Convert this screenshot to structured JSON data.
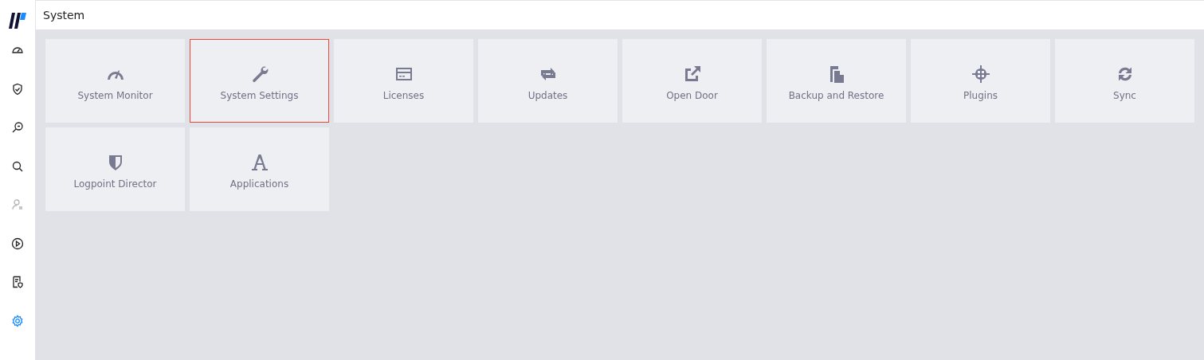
{
  "header": {
    "title": "System"
  },
  "sidebar": {
    "items": [
      {
        "selected": false,
        "disabled": false
      },
      {
        "selected": false,
        "disabled": false
      },
      {
        "selected": false,
        "disabled": false
      },
      {
        "selected": false,
        "disabled": false
      },
      {
        "selected": false,
        "disabled": true
      },
      {
        "selected": false,
        "disabled": false
      },
      {
        "selected": false,
        "disabled": false
      },
      {
        "selected": true,
        "disabled": false
      }
    ]
  },
  "tiles": [
    {
      "label": "System Monitor",
      "selected": false
    },
    {
      "label": "System Settings",
      "selected": true
    },
    {
      "label": "Licenses",
      "selected": false
    },
    {
      "label": "Updates",
      "selected": false
    },
    {
      "label": "Open Door",
      "selected": false
    },
    {
      "label": "Backup and Restore",
      "selected": false
    },
    {
      "label": "Plugins",
      "selected": false
    },
    {
      "label": "Sync",
      "selected": false
    },
    {
      "label": "Logpoint Director",
      "selected": false
    },
    {
      "label": "Applications",
      "selected": false
    }
  ]
}
